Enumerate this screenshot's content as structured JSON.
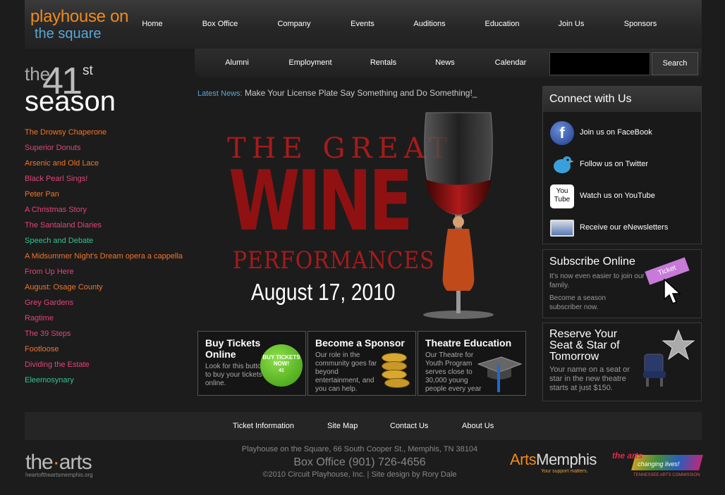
{
  "logo": {
    "line1": "playhouse on",
    "line2": "the square"
  },
  "main_nav": [
    "Home",
    "Box Office",
    "Company",
    "Events",
    "Auditions",
    "Education",
    "Join Us",
    "Sponsors"
  ],
  "sub_nav": [
    "Alumni",
    "Employment",
    "Rentals",
    "News",
    "Calendar"
  ],
  "search": {
    "placeholder": "",
    "button": "Search"
  },
  "season": {
    "the": "the",
    "number": "41",
    "suffix": "st",
    "word": "season"
  },
  "shows": [
    {
      "title": "The Drowsy Chaperone",
      "color": "#f0752a"
    },
    {
      "title": "Superior Donuts",
      "color": "#e2447a"
    },
    {
      "title": "Arsenic and Old Lace",
      "color": "#f0752a"
    },
    {
      "title": "Black Pearl Sings!",
      "color": "#e2447a"
    },
    {
      "title": "Peter Pan",
      "color": "#f0752a"
    },
    {
      "title": "A Christmas Story",
      "color": "#e2447a"
    },
    {
      "title": "The Santaland Diaries",
      "color": "#e2447a"
    },
    {
      "title": "Speech and Debate",
      "color": "#35c28f"
    },
    {
      "title": "A Midsummer Night's Dream opera a cappella",
      "color": "#f0752a"
    },
    {
      "title": "From Up Here",
      "color": "#e2447a"
    },
    {
      "title": "August: Osage County",
      "color": "#f0752a"
    },
    {
      "title": "Grey Gardens",
      "color": "#e2447a"
    },
    {
      "title": "Ragtime",
      "color": "#e2447a"
    },
    {
      "title": "The 39 Steps",
      "color": "#e2447a"
    },
    {
      "title": "Footloose",
      "color": "#f0752a"
    },
    {
      "title": "Dividing the Estate",
      "color": "#e2447a"
    },
    {
      "title": "Eleemosynary",
      "color": "#35c28f"
    }
  ],
  "news": {
    "label": "Latest News:",
    "text": "Make Your License Plate Say Something and Do Something!_"
  },
  "hero": {
    "line1": "THE GREAT",
    "line2": "WINE",
    "line3": "PERFORMANCES",
    "date": "August 17, 2010"
  },
  "boxes": {
    "tickets": {
      "title": "Buy Tickets Online",
      "text": "Look for this button to buy your tickets online.",
      "badge": "BUY TICKETS NOW!",
      "badge_sub": "41"
    },
    "sponsor": {
      "title": "Become a Sponsor",
      "text": "Our role in the community goes far beyond entertainment, and you can help."
    },
    "education": {
      "title": "Theatre Education",
      "text": "Our Theatre for Youth Program serves close to 30,000 young people every year"
    }
  },
  "connect": {
    "title": "Connect with Us",
    "items": [
      {
        "label": "Join us on FaceBook",
        "icon": "facebook-icon"
      },
      {
        "label": "Follow us on Twitter",
        "icon": "twitter-icon"
      },
      {
        "label": "Watch us on YouTube",
        "icon": "youtube-icon",
        "icon_text": "You Tube"
      },
      {
        "label": "Receive our eNewsletters",
        "icon": "newsletter-icon"
      }
    ]
  },
  "subscribe": {
    "title": "Subscribe Online",
    "text1": "It's now even easier to join our family.",
    "text2": "Become a season subscriber now.",
    "ticket_word": "Ticket"
  },
  "reserve": {
    "title": "Reserve Your Seat & Star of Tomorrow",
    "text": "Your name on a seat or star in the new theatre starts at just $150."
  },
  "footer_nav": [
    "Ticket Information",
    "Site Map",
    "Contact Us",
    "About Us"
  ],
  "footer": {
    "address": "Playhouse on the Square, 66 South Cooper St., Memphis, TN 38104",
    "boxoffice": "Box Office (901) 726-4656",
    "copyright": "©2010 Circuit Playhouse, Inc. | Site design by Rory Dale"
  },
  "sponsors": {
    "thearts": {
      "pre": "the",
      "mid": "·",
      "post": "arts",
      "sub": "heartoftheartsmemphis.org"
    },
    "artsmemphis": {
      "a": "Arts",
      "b": "Memphis",
      "tag": "Your support matters."
    },
    "tac": {
      "line1": "the arts",
      "line2": "changing lives!",
      "line3": "TENNESSEE ARTS COMMISSION"
    }
  },
  "colors": {
    "orange": "#f08a1c",
    "blue": "#5aa7d6",
    "wine_red": "#8f1111"
  }
}
